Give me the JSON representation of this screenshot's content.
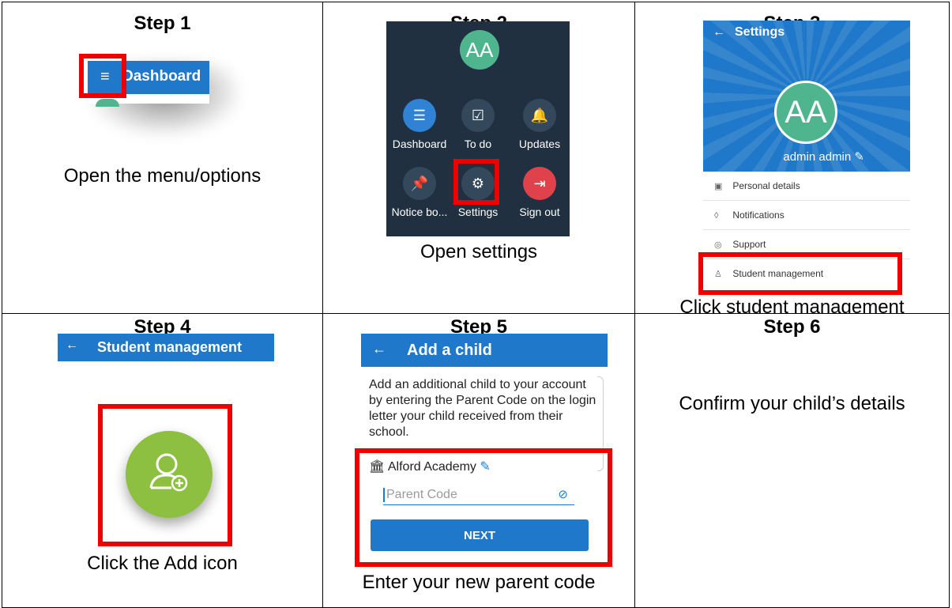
{
  "steps": [
    {
      "title": "Step 1",
      "caption": "Open the menu/options",
      "ui": {
        "bar_title": "Dashboard",
        "menu_icon": "hamburger-menu-icon"
      }
    },
    {
      "title": "Step 2",
      "caption": "Open settings",
      "ui": {
        "avatar": "AA",
        "items": [
          {
            "label": "Dashboard",
            "icon": "dashboard-icon",
            "glyph": "☰"
          },
          {
            "label": "To do",
            "icon": "todo-icon",
            "glyph": "☑"
          },
          {
            "label": "Updates",
            "icon": "bell-icon",
            "glyph": "🔔"
          },
          {
            "label": "Notice bo...",
            "icon": "pin-icon",
            "glyph": "📌"
          },
          {
            "label": "Settings",
            "icon": "gear-icon",
            "glyph": "⚙"
          },
          {
            "label": "Sign out",
            "icon": "sign-out-icon",
            "glyph": "⇥"
          }
        ]
      }
    },
    {
      "title": "Step 3",
      "caption": "Click student management",
      "ui": {
        "header_title": "Settings",
        "avatar": "AA",
        "name": "admin admin",
        "items": [
          {
            "label": "Personal details",
            "icon": "id-card-icon",
            "glyph": "▣"
          },
          {
            "label": "Notifications",
            "icon": "bell-icon",
            "glyph": "◊"
          },
          {
            "label": "Support",
            "icon": "support-icon",
            "glyph": "◎"
          },
          {
            "label": "Student management",
            "icon": "user-icon",
            "glyph": "♙"
          }
        ]
      }
    },
    {
      "title": "Step 4",
      "caption": "Click the Add icon",
      "ui": {
        "bar_title": "Student management",
        "button_icon": "add-user-icon"
      }
    },
    {
      "title": "Step 5",
      "caption": "Enter your new parent code",
      "ui": {
        "bar_title": "Add a child",
        "description": "Add an additional child to your account by entering the Parent Code on the login letter your child received from their school.",
        "school": "Alford Academy",
        "placeholder": "Parent Code",
        "button": "NEXT"
      }
    },
    {
      "title": "Step 6",
      "caption": "Confirm your child’s details"
    }
  ],
  "colors": {
    "primary": "#1f78c9",
    "green": "#4fb58f",
    "add_green": "#8dc040",
    "highlight": "#ee0000",
    "dark_panel": "#203040"
  }
}
